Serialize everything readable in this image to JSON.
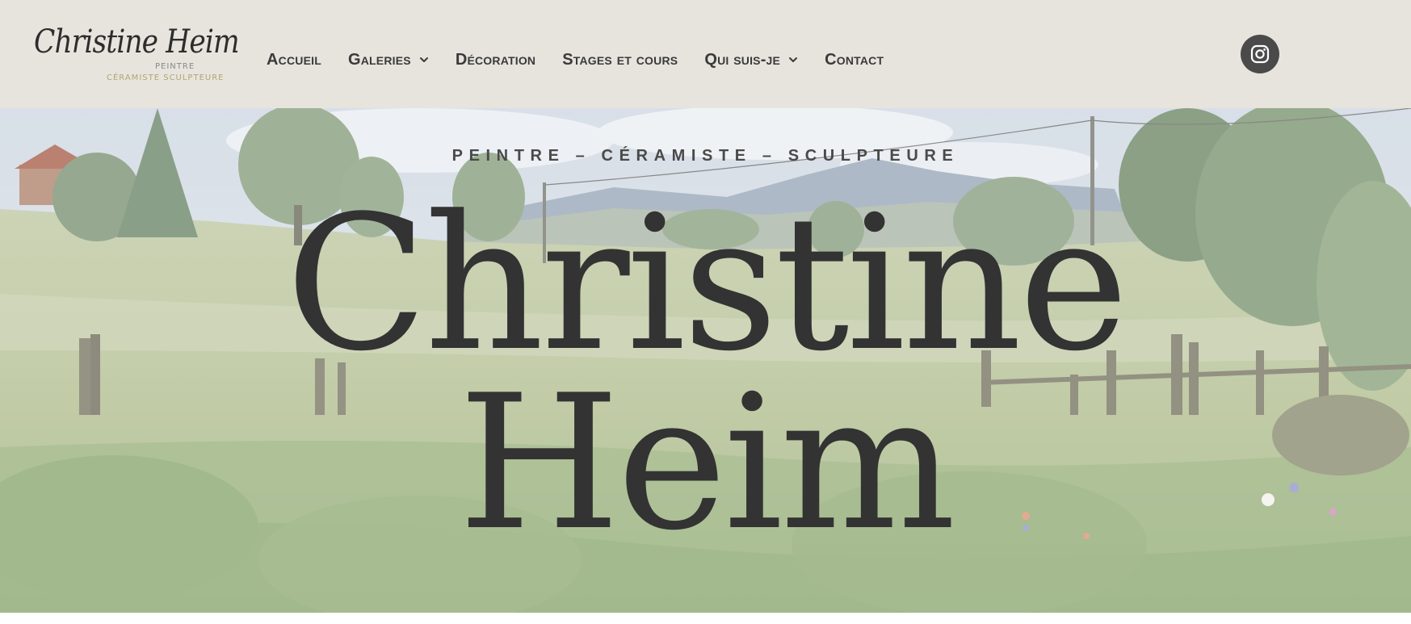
{
  "header": {
    "logo": {
      "script_text": "Christine Heim",
      "line1": "PEINTRE",
      "line2": "CÉRAMISTE SCULPTEURE"
    },
    "nav": [
      {
        "label": "Accueil",
        "has_dropdown": false
      },
      {
        "label": "Galeries",
        "has_dropdown": true
      },
      {
        "label": "Décoration",
        "has_dropdown": false
      },
      {
        "label": "Stages et cours",
        "has_dropdown": false
      },
      {
        "label": "Qui suis-je",
        "has_dropdown": true
      },
      {
        "label": "Contact",
        "has_dropdown": false
      }
    ],
    "social": {
      "icon": "instagram-icon"
    }
  },
  "hero": {
    "subtitle": "PEINTRE – CÉRAMISTE – SCULPTEURE",
    "name_line1": "Christine",
    "name_line2": "Heim"
  },
  "colors": {
    "header_bg": "#e7e4de",
    "nav_text": "#3a3a3a",
    "logo_accent": "#b1a66e",
    "hero_text": "#333333",
    "social_bg": "#4a4a4a"
  }
}
